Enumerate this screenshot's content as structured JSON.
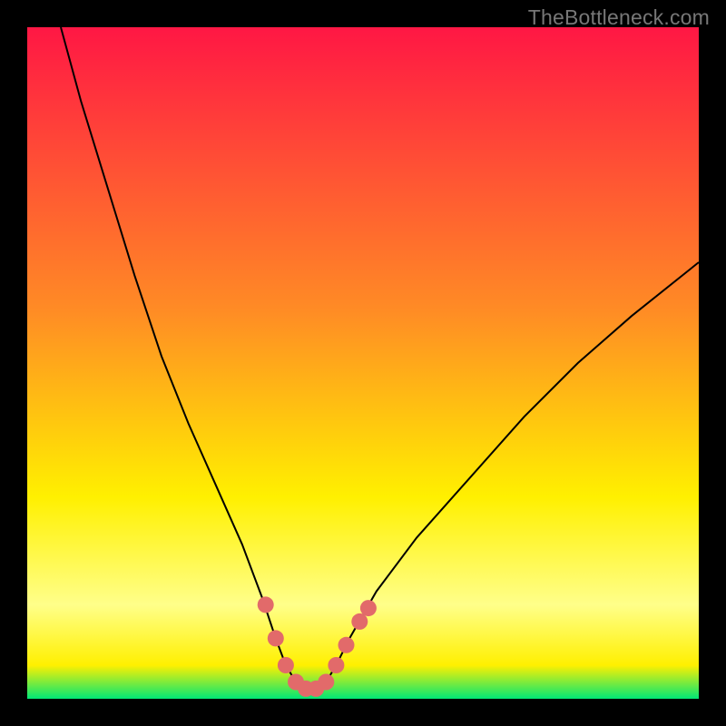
{
  "watermark": "TheBottleneck.com",
  "palette": {
    "gradient_top": "#ff1744",
    "gradient_mid1": "#ff8b25",
    "gradient_mid2": "#fff000",
    "gradient_accent": "#ffff8a",
    "gradient_bottom": "#00e676",
    "curve_stroke": "#000000",
    "marker_fill": "#e26a6a",
    "frame_bg": "#000000"
  },
  "chart_data": {
    "type": "line",
    "title": "",
    "xlabel": "",
    "ylabel": "",
    "xlim": [
      0,
      100
    ],
    "ylim": [
      0,
      100
    ],
    "grid": false,
    "legend": false,
    "series": [
      {
        "name": "bottleneck-curve",
        "x": [
          5,
          8,
          12,
          16,
          20,
          24,
          28,
          32,
          35,
          37,
          38.5,
          40,
          41.5,
          43,
          44.5,
          46,
          48,
          52,
          58,
          66,
          74,
          82,
          90,
          100
        ],
        "y": [
          100,
          89,
          76,
          63,
          51,
          41,
          32,
          23,
          15,
          9,
          5,
          2.5,
          1.5,
          1.5,
          2.5,
          5,
          9,
          16,
          24,
          33,
          42,
          50,
          57,
          65
        ]
      }
    ],
    "markers": [
      {
        "name": "highlight-points",
        "x": [
          35.5,
          37,
          38.5,
          40,
          41.5,
          43,
          44.5,
          46,
          47.5,
          49.5,
          50.8
        ],
        "y": [
          14,
          9,
          5,
          2.5,
          1.5,
          1.5,
          2.5,
          5,
          8,
          11.5,
          13.5
        ]
      }
    ]
  }
}
